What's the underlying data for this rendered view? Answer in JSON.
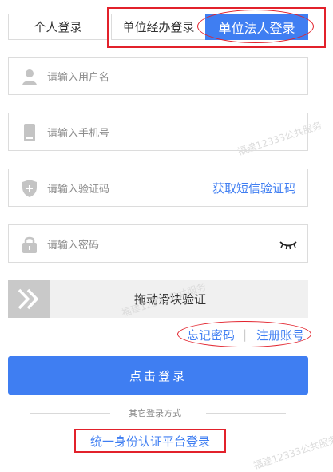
{
  "tabs": [
    {
      "label": "个人登录"
    },
    {
      "label": "单位经办登录"
    },
    {
      "label": "单位法人登录"
    }
  ],
  "fields": {
    "username_placeholder": "请输入用户名",
    "phone_placeholder": "请输入手机号",
    "code_placeholder": "请输入验证码",
    "sms_link": "获取短信验证码",
    "password_placeholder": "请输入密码"
  },
  "slider": {
    "label": "拖动滑块验证"
  },
  "links": {
    "forgot_password": "忘记密码",
    "divider": "|",
    "register": "注册账号"
  },
  "login_button": "点击登录",
  "other_methods": "其它登录方式",
  "unified_login": "统一身份认证平台登录",
  "watermark": "福建12333公共服务",
  "colors": {
    "accent": "#3f7ef2",
    "annotation_red": "#e2212b"
  }
}
